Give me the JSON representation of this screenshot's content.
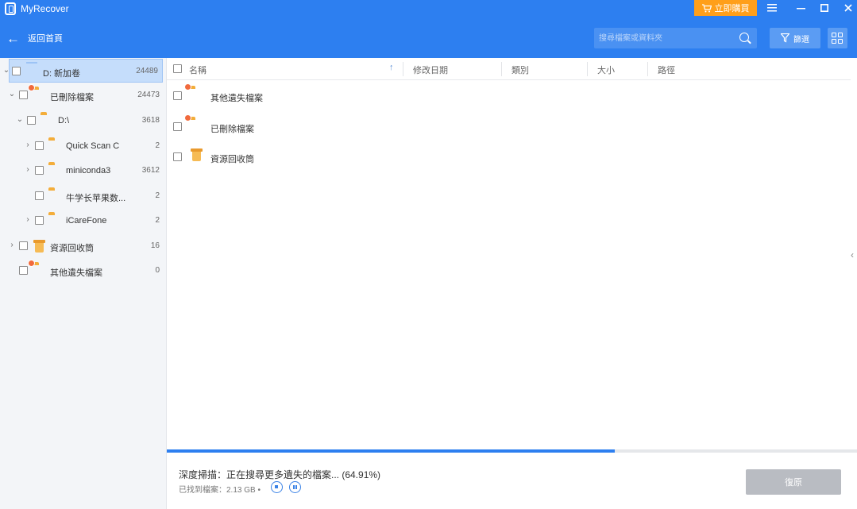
{
  "app": {
    "title": "MyRecover",
    "buy_label": "立即購買",
    "back_label": "返回首頁"
  },
  "search": {
    "placeholder": "搜尋檔案或資料夾"
  },
  "toolbar": {
    "filter_label": "篩選"
  },
  "sidebar": {
    "items": [
      {
        "label": "D: 新加卷",
        "count": "24489",
        "icon": "drive-icon",
        "selected": true
      },
      {
        "label": "已刪除檔案",
        "count": "24473",
        "icon": "deleted-folder-icon"
      },
      {
        "label": "D:\\",
        "count": "3618",
        "icon": "folder-icon"
      },
      {
        "label": "Quick Scan C",
        "count": "2",
        "icon": "folder-icon"
      },
      {
        "label": "miniconda3",
        "count": "3612",
        "icon": "folder-icon"
      },
      {
        "label": "牛学长苹果数...",
        "count": "2",
        "icon": "folder-icon"
      },
      {
        "label": "iCareFone",
        "count": "2",
        "icon": "folder-icon"
      },
      {
        "label": "資源回收筒",
        "count": "16",
        "icon": "recycle-bin-icon"
      },
      {
        "label": "其他遺失檔案",
        "count": "0",
        "icon": "lost-files-folder-icon"
      }
    ]
  },
  "table": {
    "columns": [
      "名稱",
      "修改日期",
      "類別",
      "大小",
      "路徑"
    ],
    "rows": [
      {
        "name": "其他遺失檔案",
        "icon": "lost-files-folder-icon"
      },
      {
        "name": "已刪除檔案",
        "icon": "deleted-folder-icon"
      },
      {
        "name": "資源回收筒",
        "icon": "recycle-bin-icon"
      }
    ]
  },
  "footer": {
    "status": "深度掃描：正在搜尋更多遺失的檔案... (64.91%)",
    "progress_percent": 64.91,
    "found_label": "已找到檔案：2.13 GB •",
    "recover_label": "復原"
  },
  "colors": {
    "accent": "#2d7ff0",
    "buy": "#ff9f1a",
    "folder": "#f8c05c",
    "selected_row": "#c5ddfb",
    "recover_disabled": "#b9bcc2"
  }
}
